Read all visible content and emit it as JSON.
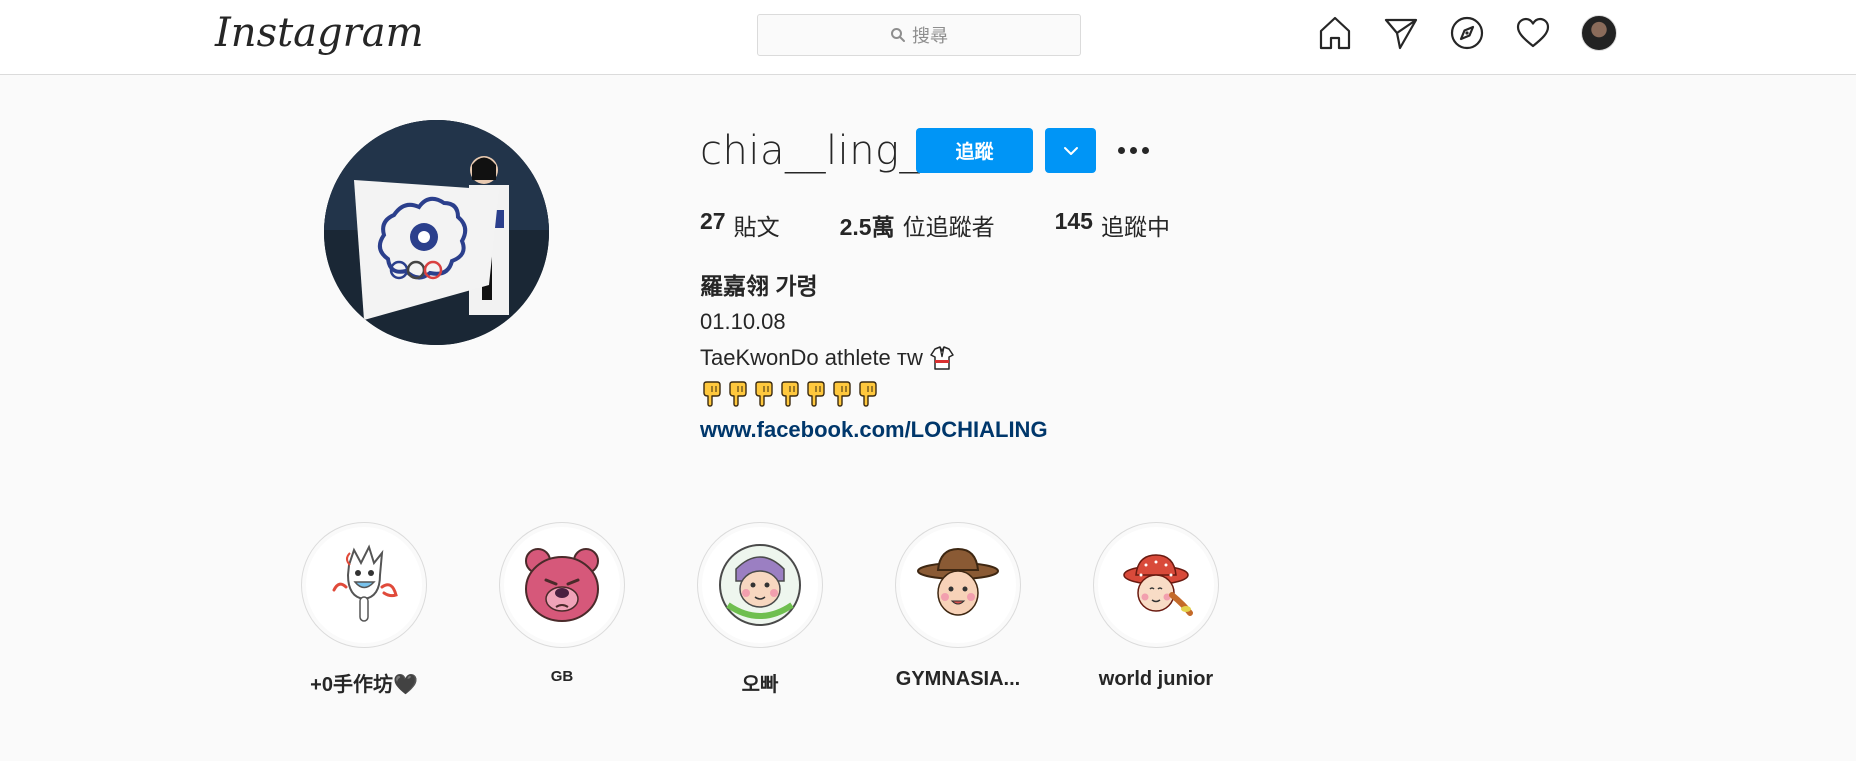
{
  "header": {
    "logo": "Instagram",
    "search_placeholder": "搜尋",
    "nav": [
      {
        "name": "home-icon"
      },
      {
        "name": "direct-icon"
      },
      {
        "name": "explore-icon"
      },
      {
        "name": "activity-icon"
      },
      {
        "name": "profile-avatar"
      }
    ]
  },
  "profile": {
    "username": "chia__ling_",
    "follow_label": "追蹤",
    "stats": {
      "posts_count": "27",
      "posts_label": "貼文",
      "followers_count": "2.5萬",
      "followers_label": "位追蹤者",
      "following_count": "145",
      "following_label": "追蹤中"
    },
    "bio": {
      "full_name": "羅嘉翎 가령",
      "line1": "01.10.08",
      "line2": "TaeKwonDo athlete ᴛᴡ",
      "pointing_emoji_count": 7,
      "link": "www.facebook.com/LOCHIALING"
    }
  },
  "highlights": [
    {
      "label": "+0手作坊🖤"
    },
    {
      "label": "GB"
    },
    {
      "label": "오빠"
    },
    {
      "label": "GYMNASIA..."
    },
    {
      "label": "world junior"
    }
  ],
  "colors": {
    "accent": "#0095f6",
    "link": "#00376b",
    "border": "#dbdbdb",
    "background": "#fafafa"
  }
}
